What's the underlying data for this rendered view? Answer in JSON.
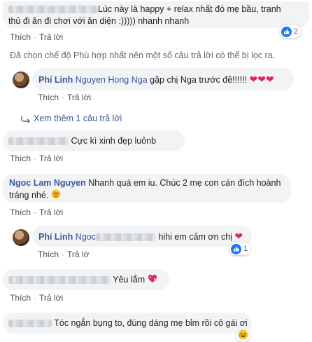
{
  "comments": [
    {
      "id": "c1",
      "text_line1": "Lúc này là happy + relax nhất đó mẹ bầu, tranh",
      "text_line2": "thủ đi ăn đi chơi với ăn diện :))))) nhanh nhanh",
      "actions": [
        "Thích",
        "Trả lời"
      ],
      "reaction_count": "2"
    }
  ],
  "filter_notice": "Đã chọn chế độ Phù hợp nhất nên một số câu trả lời có thể bị lọc ra.",
  "reply1": {
    "author": "Phí Linh",
    "tagged": "Nguyen Hong Nga",
    "text": "gặp chị Nga trước đê!!!!!!",
    "actions": [
      "Thích",
      "Trả lời"
    ]
  },
  "more_replies": "Xem thêm 1 câu trả lời",
  "c2": {
    "text": "Cực kì xinh đẹp luônb",
    "actions": [
      "Thích",
      "Trả lời"
    ]
  },
  "c3": {
    "author": "Ngoc Lam Nguyen",
    "text_line1": "Nhanh quá em iu. Chúc 2 mẹ con cán đích hoành",
    "text_line2": "tráng nhé.",
    "actions": [
      "Thích",
      "Trả lời"
    ]
  },
  "reply2": {
    "author": "Phí Linh",
    "tagged_partial": "Ngoc",
    "text": "hihi em cảm ơn chị",
    "actions": [
      "Thích",
      "Trả lờ"
    ],
    "reaction_count": "1"
  },
  "c4": {
    "text": "Yêu lắm",
    "actions": [
      "Thích",
      "Trả lời"
    ]
  },
  "c5": {
    "text": "Tóc ngắn bụng to, đúng dáng mẹ bỉm rồi cô gái ơi"
  },
  "colors": {
    "link": "#385898",
    "bubble": "#f2f3f5",
    "like": "#1877f2",
    "heart": "#e0245e"
  }
}
